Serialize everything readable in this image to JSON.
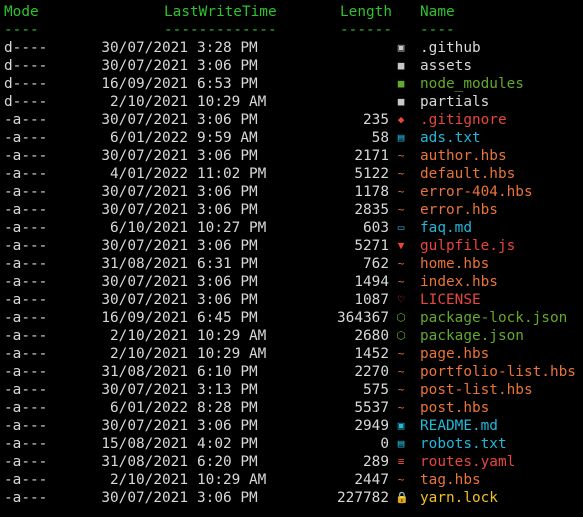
{
  "header": {
    "mode": "Mode",
    "lastwritetime": "LastWriteTime",
    "length": "Length",
    "name": "Name",
    "mode_rule": "----",
    "lastwritetime_rule": "-------------",
    "length_rule": "------",
    "name_rule": "----"
  },
  "colors": {
    "header": "#2fc12f",
    "default": "#d8d8d8",
    "markup": "#e8743a",
    "cyan": "#22b8d8",
    "node": "#64a82c",
    "red": "#e8463c",
    "folder": "#c8c8c8",
    "lock": "#f0c020"
  },
  "rows": [
    {
      "mode": "d----",
      "date": "30/07/2021",
      "time": "3:28 PM",
      "length": "",
      "icon": "folder-github-icon",
      "glyph": "▣",
      "name": ".github",
      "color": "#d8d8d8",
      "icon_color": "#c8c8c8"
    },
    {
      "mode": "d----",
      "date": "30/07/2021",
      "time": "3:06 PM",
      "length": "",
      "icon": "folder-icon",
      "glyph": "■",
      "name": "assets",
      "color": "#d8d8d8",
      "icon_color": "#c8c8c8"
    },
    {
      "mode": "d----",
      "date": "16/09/2021",
      "time": "6:53 PM",
      "length": "",
      "icon": "folder-node-icon",
      "glyph": "■",
      "name": "node_modules",
      "color": "#64a82c",
      "icon_color": "#64a82c"
    },
    {
      "mode": "d----",
      "date": "2/10/2021",
      "time": "10:29 AM",
      "length": "",
      "icon": "folder-icon",
      "glyph": "■",
      "name": "partials",
      "color": "#d8d8d8",
      "icon_color": "#c8c8c8"
    },
    {
      "mode": "-a---",
      "date": "30/07/2021",
      "time": "3:06 PM",
      "length": "235",
      "icon": "git-icon",
      "glyph": "◆",
      "name": ".gitignore",
      "color": "#e8463c",
      "icon_color": "#e8463c"
    },
    {
      "mode": "-a---",
      "date": "6/01/2022",
      "time": "9:59 AM",
      "length": "58",
      "icon": "text-file-icon",
      "glyph": "▤",
      "name": "ads.txt",
      "color": "#22b8d8",
      "icon_color": "#22b8d8"
    },
    {
      "mode": "-a---",
      "date": "30/07/2021",
      "time": "3:06 PM",
      "length": "2171",
      "icon": "handlebars-icon",
      "glyph": "~",
      "name": "author.hbs",
      "color": "#e8743a",
      "icon_color": "#e8743a"
    },
    {
      "mode": "-a---",
      "date": "4/01/2022",
      "time": "11:02 PM",
      "length": "5122",
      "icon": "handlebars-icon",
      "glyph": "~",
      "name": "default.hbs",
      "color": "#e8743a",
      "icon_color": "#e8743a"
    },
    {
      "mode": "-a---",
      "date": "30/07/2021",
      "time": "3:06 PM",
      "length": "1178",
      "icon": "handlebars-icon",
      "glyph": "~",
      "name": "error-404.hbs",
      "color": "#e8743a",
      "icon_color": "#e8743a"
    },
    {
      "mode": "-a---",
      "date": "30/07/2021",
      "time": "3:06 PM",
      "length": "2835",
      "icon": "handlebars-icon",
      "glyph": "~",
      "name": "error.hbs",
      "color": "#e8743a",
      "icon_color": "#e8743a"
    },
    {
      "mode": "-a---",
      "date": "6/10/2021",
      "time": "10:27 PM",
      "length": "603",
      "icon": "markdown-icon",
      "glyph": "▭",
      "name": "faq.md",
      "color": "#22b8d8",
      "icon_color": "#22b8d8"
    },
    {
      "mode": "-a---",
      "date": "30/07/2021",
      "time": "3:06 PM",
      "length": "5271",
      "icon": "gulp-icon",
      "glyph": "▼",
      "name": "gulpfile.js",
      "color": "#e8463c",
      "icon_color": "#e8463c"
    },
    {
      "mode": "-a---",
      "date": "31/08/2021",
      "time": "6:31 PM",
      "length": "762",
      "icon": "handlebars-icon",
      "glyph": "~",
      "name": "home.hbs",
      "color": "#e8743a",
      "icon_color": "#e8743a"
    },
    {
      "mode": "-a---",
      "date": "30/07/2021",
      "time": "3:06 PM",
      "length": "1494",
      "icon": "handlebars-icon",
      "glyph": "~",
      "name": "index.hbs",
      "color": "#e8743a",
      "icon_color": "#e8743a"
    },
    {
      "mode": "-a---",
      "date": "30/07/2021",
      "time": "3:06 PM",
      "length": "1087",
      "icon": "license-icon",
      "glyph": "♡",
      "name": "LICENSE",
      "color": "#e8463c",
      "icon_color": "#e8463c"
    },
    {
      "mode": "-a---",
      "date": "16/09/2021",
      "time": "6:45 PM",
      "length": "364367",
      "icon": "nodejs-icon",
      "glyph": "⬡",
      "name": "package-lock.json",
      "color": "#64a82c",
      "icon_color": "#64a82c"
    },
    {
      "mode": "-a---",
      "date": "2/10/2021",
      "time": "10:29 AM",
      "length": "2680",
      "icon": "nodejs-icon",
      "glyph": "⬡",
      "name": "package.json",
      "color": "#64a82c",
      "icon_color": "#64a82c"
    },
    {
      "mode": "-a---",
      "date": "2/10/2021",
      "time": "10:29 AM",
      "length": "1452",
      "icon": "handlebars-icon",
      "glyph": "~",
      "name": "page.hbs",
      "color": "#e8743a",
      "icon_color": "#e8743a"
    },
    {
      "mode": "-a---",
      "date": "31/08/2021",
      "time": "6:10 PM",
      "length": "2270",
      "icon": "handlebars-icon",
      "glyph": "~",
      "name": "portfolio-list.hbs",
      "color": "#e8743a",
      "icon_color": "#e8743a"
    },
    {
      "mode": "-a---",
      "date": "30/07/2021",
      "time": "3:13 PM",
      "length": "575",
      "icon": "handlebars-icon",
      "glyph": "~",
      "name": "post-list.hbs",
      "color": "#e8743a",
      "icon_color": "#e8743a"
    },
    {
      "mode": "-a---",
      "date": "6/01/2022",
      "time": "8:28 PM",
      "length": "5537",
      "icon": "handlebars-icon",
      "glyph": "~",
      "name": "post.hbs",
      "color": "#e8743a",
      "icon_color": "#e8743a"
    },
    {
      "mode": "-a---",
      "date": "30/07/2021",
      "time": "3:06 PM",
      "length": "2949",
      "icon": "readme-icon",
      "glyph": "▣",
      "name": "README.md",
      "color": "#22b8d8",
      "icon_color": "#22b8d8"
    },
    {
      "mode": "-a---",
      "date": "15/08/2021",
      "time": "4:02 PM",
      "length": "0",
      "icon": "text-file-icon",
      "glyph": "▤",
      "name": "robots.txt",
      "color": "#22b8d8",
      "icon_color": "#22b8d8"
    },
    {
      "mode": "-a---",
      "date": "31/08/2021",
      "time": "6:20 PM",
      "length": "289",
      "icon": "yaml-icon",
      "glyph": "≡",
      "name": "routes.yaml",
      "color": "#e8463c",
      "icon_color": "#e8463c"
    },
    {
      "mode": "-a---",
      "date": "2/10/2021",
      "time": "10:29 AM",
      "length": "2447",
      "icon": "handlebars-icon",
      "glyph": "~",
      "name": "tag.hbs",
      "color": "#e8743a",
      "icon_color": "#e8743a"
    },
    {
      "mode": "-a---",
      "date": "30/07/2021",
      "time": "3:06 PM",
      "length": "227782",
      "icon": "lock-icon",
      "glyph": "🔒",
      "name": "yarn.lock",
      "color": "#f0c020",
      "icon_color": "#f0c020"
    }
  ]
}
